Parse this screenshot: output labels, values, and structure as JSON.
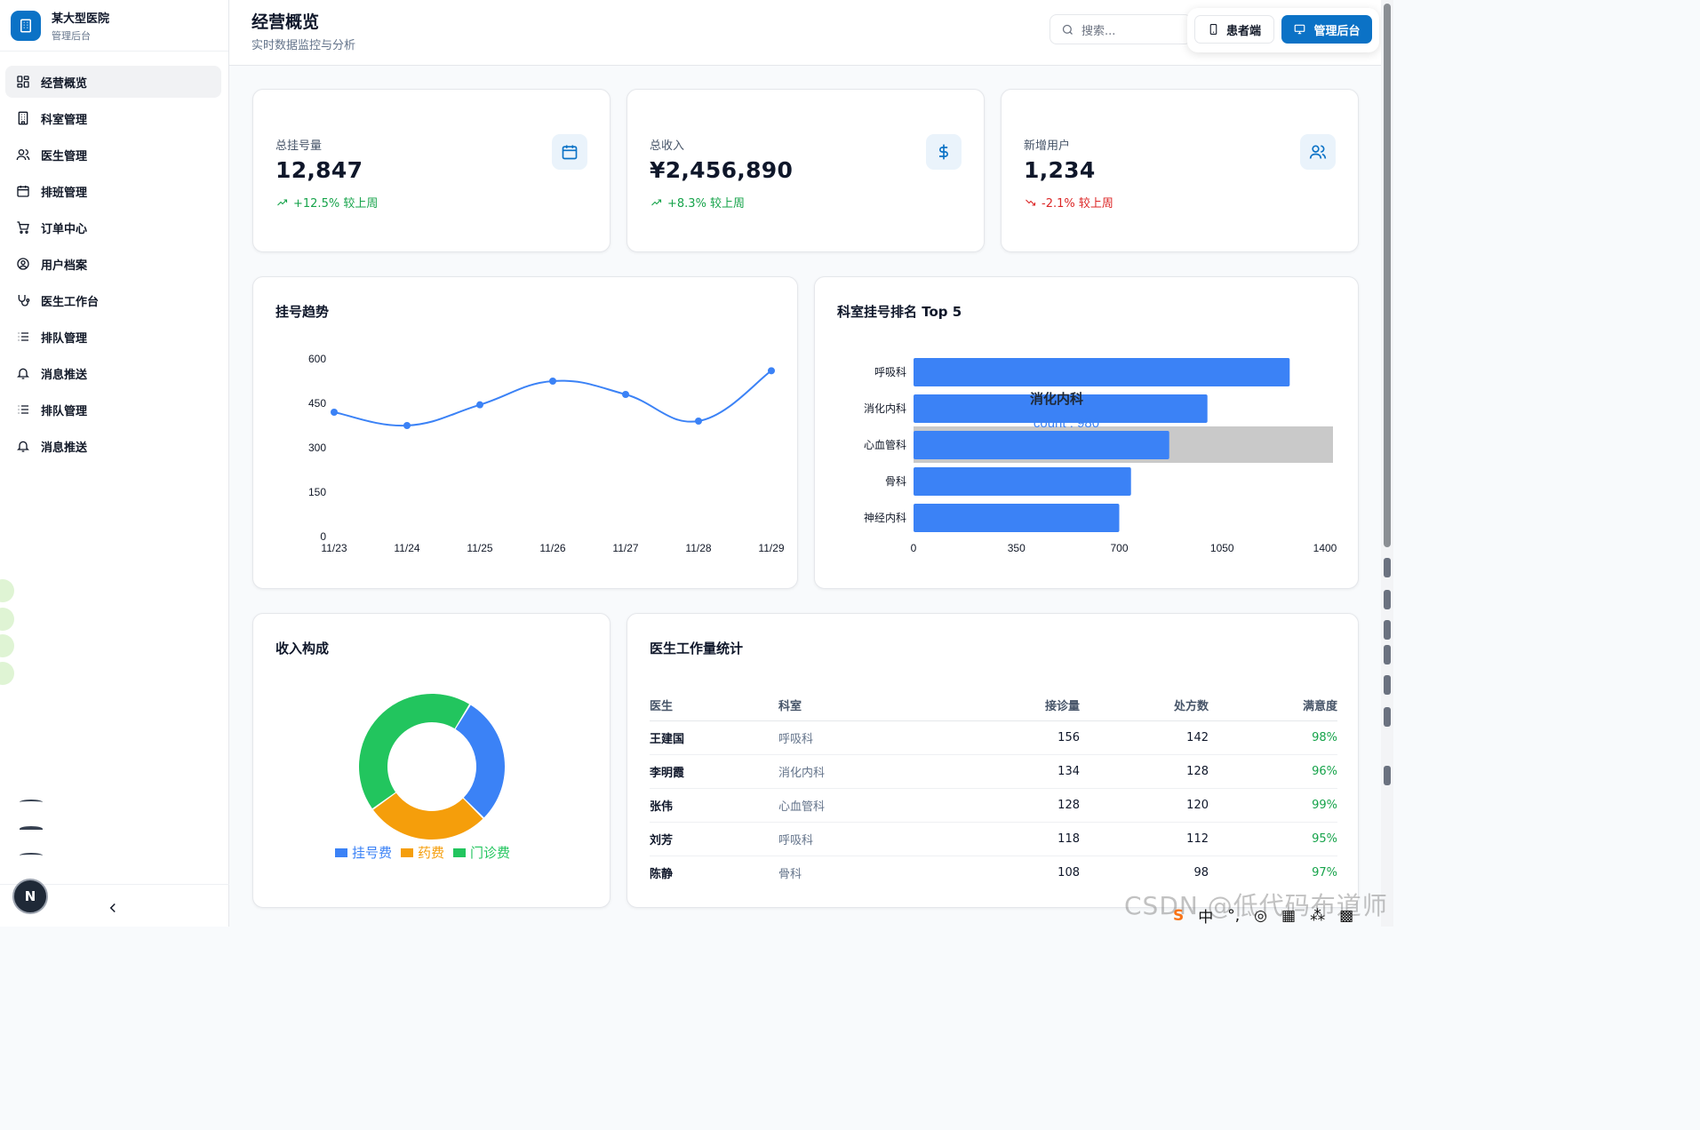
{
  "brand": {
    "name": "某大型医院",
    "subtitle": "管理后台"
  },
  "sidebar": {
    "items": [
      {
        "label": "经营概览",
        "icon": "dashboard-icon",
        "active": true
      },
      {
        "label": "科室管理",
        "icon": "building-icon"
      },
      {
        "label": "医生管理",
        "icon": "users-icon"
      },
      {
        "label": "排班管理",
        "icon": "calendar-icon"
      },
      {
        "label": "订单中心",
        "icon": "cart-icon"
      },
      {
        "label": "用户档案",
        "icon": "user-circle-icon"
      },
      {
        "label": "医生工作台",
        "icon": "stethoscope-icon"
      },
      {
        "label": "排队管理",
        "icon": "list-icon"
      },
      {
        "label": "消息推送",
        "icon": "bell-icon"
      },
      {
        "label": "排队管理",
        "icon": "list-icon"
      },
      {
        "label": "消息推送",
        "icon": "bell-icon"
      }
    ],
    "avatar": "N"
  },
  "header": {
    "title": "经营概览",
    "subtitle": "实时数据监控与分析",
    "search_placeholder": "搜索...",
    "patient_btn": "患者端",
    "admin_btn": "管理后台"
  },
  "stats": [
    {
      "label": "总挂号量",
      "value": "12,847",
      "change": "+12.5% 较上周",
      "trend": "up",
      "icon": "calendar-icon"
    },
    {
      "label": "总收入",
      "value": "¥2,456,890",
      "change": "+8.3% 较上周",
      "trend": "up",
      "icon": "dollar-icon"
    },
    {
      "label": "新增用户",
      "value": "1,234",
      "change": "-2.1% 较上周",
      "trend": "down",
      "icon": "users-icon"
    }
  ],
  "colors": {
    "primary": "#0b72c6",
    "chart_blue": "#3b82f6",
    "orange": "#f59e0b",
    "green": "#22c55e",
    "up": "#16a34a",
    "down": "#dc2626"
  },
  "chart_data": [
    {
      "id": "registration_trend",
      "type": "line",
      "title": "挂号趋势",
      "categories": [
        "11/23",
        "11/24",
        "11/25",
        "11/26",
        "11/27",
        "11/28",
        "11/29"
      ],
      "series": [
        {
          "values": [
            420,
            375,
            445,
            525,
            480,
            390,
            560
          ]
        }
      ],
      "ylim": [
        0,
        600
      ],
      "yticks": [
        0,
        150,
        300,
        450,
        600
      ],
      "grid": false
    },
    {
      "id": "dept_top5",
      "type": "bar",
      "orientation": "horizontal",
      "title": "科室挂号排名 Top 5",
      "categories": [
        "呼吸科",
        "消化内科",
        "心血管科",
        "骨科",
        "神经内科"
      ],
      "values": [
        1280,
        1000,
        870,
        740,
        700
      ],
      "xlim": [
        0,
        1400
      ],
      "xticks": [
        0,
        350,
        700,
        1050,
        1400
      ],
      "tooltip": {
        "category": "消化内科",
        "text": "count : 980"
      }
    },
    {
      "id": "income_composition",
      "type": "pie",
      "donut": true,
      "title": "收入构成",
      "slices": [
        {
          "name": "挂号费",
          "value": 25,
          "color": "#3b82f6"
        },
        {
          "name": "药费",
          "value": 24,
          "color": "#f59e0b"
        },
        {
          "name": "门诊费",
          "value": 38,
          "color": "#22c55e"
        }
      ]
    }
  ],
  "workload": {
    "title": "医生工作量统计",
    "columns": [
      "医生",
      "科室",
      "接诊量",
      "处方数",
      "满意度"
    ],
    "rows": [
      [
        "王建国",
        "呼吸科",
        "156",
        "142",
        "98%"
      ],
      [
        "李明霞",
        "消化内科",
        "134",
        "128",
        "96%"
      ],
      [
        "张伟",
        "心血管科",
        "128",
        "120",
        "99%"
      ],
      [
        "刘芳",
        "呼吸科",
        "118",
        "112",
        "95%"
      ],
      [
        "陈静",
        "骨科",
        "108",
        "98",
        "97%"
      ]
    ]
  },
  "watermark": "CSDN @低代码布道师",
  "tray": {
    "ime": "中"
  }
}
